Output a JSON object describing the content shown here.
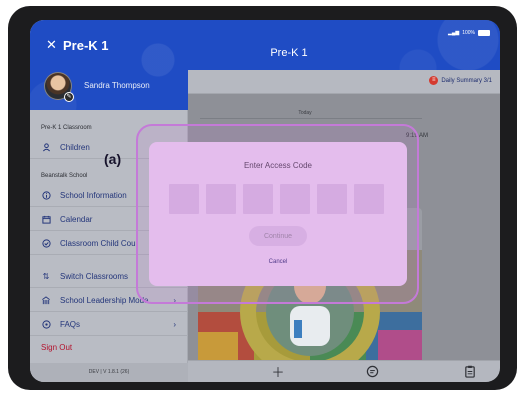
{
  "sidebar": {
    "close_icon": "close-icon",
    "title": "Pre-K 1",
    "user_name": "Sandra Thompson",
    "section_classroom": "Pre-K 1 Classroom",
    "section_school": "Beanstalk School",
    "items": [
      {
        "label": "Children",
        "icon": "person-icon"
      },
      {
        "label": "School Information",
        "icon": "info-icon"
      },
      {
        "label": "Calendar",
        "icon": "calendar-icon"
      },
      {
        "label": "Classroom Child Cou",
        "icon": "check-circle-icon"
      },
      {
        "label": "Switch Classrooms",
        "icon": "swap-icon"
      },
      {
        "label": "School Leadership Mode",
        "icon": "school-icon"
      },
      {
        "label": "FAQs",
        "icon": "question-icon"
      }
    ],
    "sign_out": "Sign Out",
    "version": "DEV | V 1.8.1 (26)"
  },
  "header": {
    "title": "Pre-K 1",
    "status": "100%"
  },
  "main": {
    "daily_summary": "Daily Summary 3/1",
    "today_label": "Today",
    "time": "9:19 AM"
  },
  "modal": {
    "title": "Enter Access Code",
    "code_length": 6,
    "continue_label": "Continue",
    "cancel_label": "Cancel"
  },
  "annotation": {
    "label": "(a)"
  },
  "bottom_bar": {
    "icons": [
      "plus-icon",
      "note-icon",
      "clipboard-icon"
    ]
  },
  "colors": {
    "brand_blue": "#1f4cc4",
    "sign_out_red": "#b3122d",
    "modal_bg": "#e9c9f0",
    "annotation_purple": "#c47ad8"
  }
}
